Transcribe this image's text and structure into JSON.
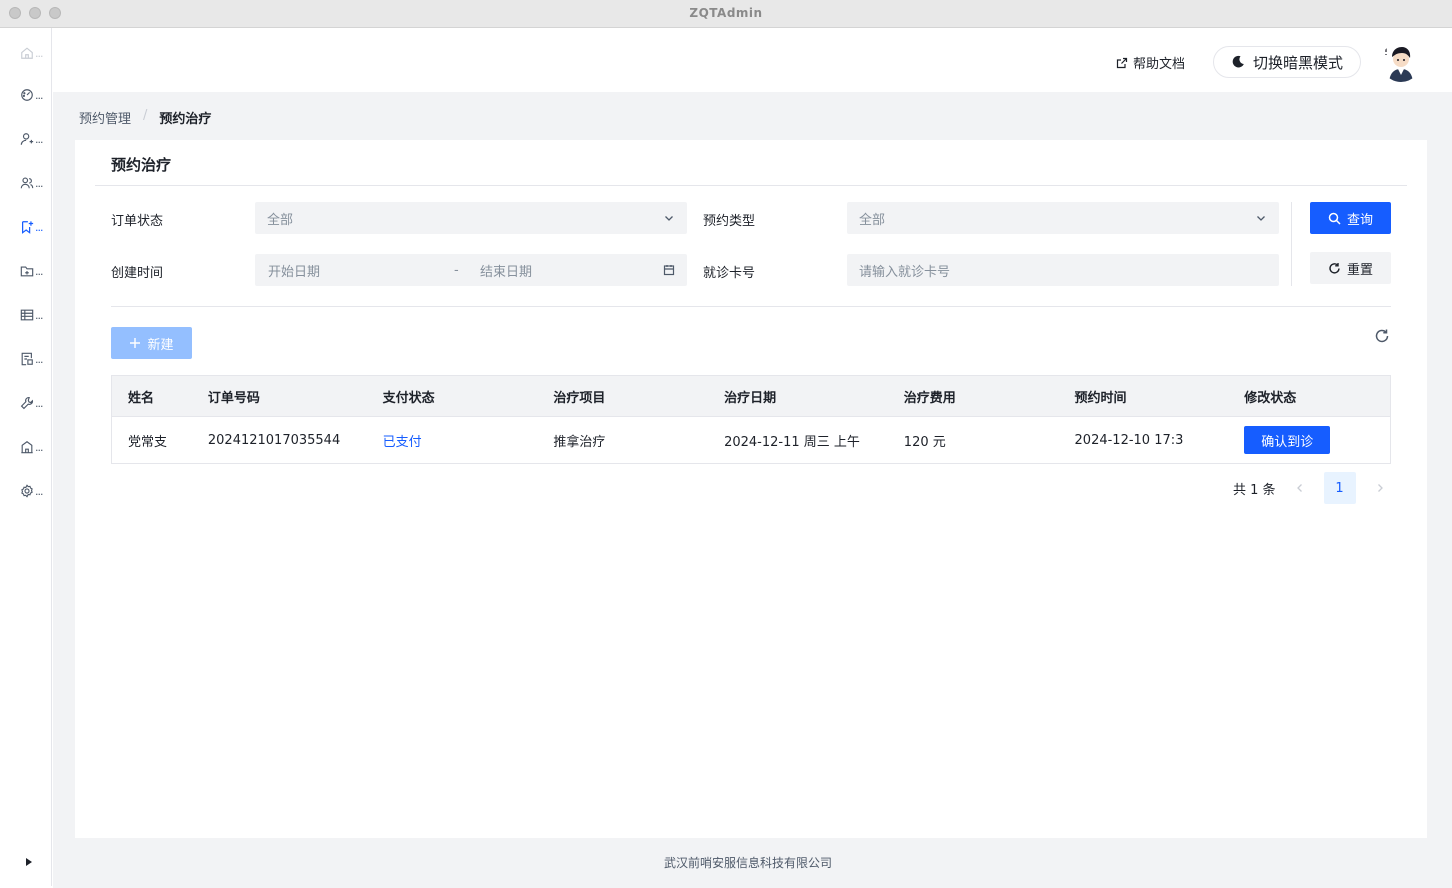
{
  "window": {
    "title": "ZQTAdmin"
  },
  "sidebar": {
    "items": [
      {
        "icon": "home-icon",
        "dots": "..."
      },
      {
        "icon": "dashboard-icon",
        "dots": "..."
      },
      {
        "icon": "user-add-icon",
        "dots": "..."
      },
      {
        "icon": "users-icon",
        "dots": "..."
      },
      {
        "icon": "bookmark-add-icon",
        "dots": "...",
        "active": true
      },
      {
        "icon": "folder-add-icon",
        "dots": "..."
      },
      {
        "icon": "table-icon",
        "dots": "..."
      },
      {
        "icon": "form-icon",
        "dots": "..."
      },
      {
        "icon": "tool-icon",
        "dots": "..."
      },
      {
        "icon": "building-icon",
        "dots": "..."
      },
      {
        "icon": "settings-icon",
        "dots": "..."
      }
    ]
  },
  "header": {
    "help_label": "帮助文档",
    "dark_mode_label": "切换暗黑模式"
  },
  "breadcrumb": {
    "parent": "预约管理",
    "separator": "/",
    "current": "预约治疗"
  },
  "card": {
    "title": "预约治疗"
  },
  "filters": {
    "order_status": {
      "label": "订单状态",
      "value": "全部"
    },
    "appointment_type": {
      "label": "预约类型",
      "value": "全部"
    },
    "created_time": {
      "label": "创建时间",
      "start_placeholder": "开始日期",
      "separator": "-",
      "end_placeholder": "结束日期"
    },
    "card_number": {
      "label": "就诊卡号",
      "placeholder": "请输入就诊卡号"
    },
    "query_label": "查询",
    "reset_label": "重置"
  },
  "toolbar": {
    "new_label": "新建"
  },
  "table": {
    "columns": [
      "姓名",
      "订单号码",
      "支付状态",
      "治疗项目",
      "治疗日期",
      "治疗费用",
      "预约时间",
      "修改状态"
    ],
    "rows": [
      {
        "name": "党常支",
        "order_no": "2024121017035544",
        "pay_status": "已支付",
        "project": "推拿治疗",
        "date": "2024-12-11 周三 上午",
        "fee": "120 元",
        "booked_at": "2024-12-10 17:3",
        "action": "确认到诊"
      }
    ]
  },
  "pagination": {
    "total": "共 1 条",
    "current": "1"
  },
  "footer": {
    "text": "武汉前哨安服信息科技有限公司"
  },
  "colors": {
    "primary": "#165dff",
    "disabled": "#94bfff",
    "bg": "#f2f3f5"
  }
}
